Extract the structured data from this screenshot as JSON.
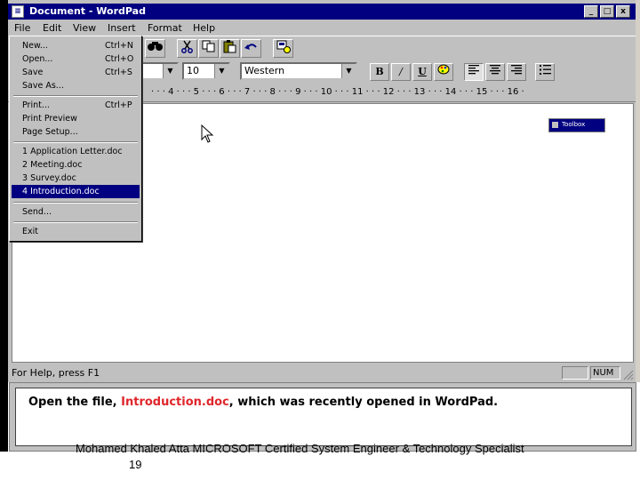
{
  "window": {
    "title": "Document - WordPad",
    "minimize": "_",
    "maximize": "□",
    "close": "x"
  },
  "menubar": {
    "items": [
      "File",
      "Edit",
      "View",
      "Insert",
      "Format",
      "Help"
    ]
  },
  "file_menu": {
    "items": [
      {
        "label": "New...",
        "shortcut": "Ctrl+N"
      },
      {
        "label": "Open...",
        "shortcut": "Ctrl+O"
      },
      {
        "label": "Save",
        "shortcut": "Ctrl+S"
      },
      {
        "label": "Save As...",
        "shortcut": ""
      },
      {
        "label": "Print...",
        "shortcut": "Ctrl+P"
      },
      {
        "label": "Print Preview",
        "shortcut": ""
      },
      {
        "label": "Page Setup...",
        "shortcut": ""
      },
      {
        "label": "1 Application Letter.doc",
        "shortcut": ""
      },
      {
        "label": "2 Meeting.doc",
        "shortcut": ""
      },
      {
        "label": "3 Survey.doc",
        "shortcut": ""
      },
      {
        "label": "4 Introduction.doc",
        "shortcut": "",
        "selected": true
      },
      {
        "label": "Send...",
        "shortcut": ""
      },
      {
        "label": "Exit",
        "shortcut": ""
      }
    ]
  },
  "toolbar": {
    "icons": [
      "find-icon",
      "cut-icon",
      "copy-icon",
      "paste-icon",
      "undo-icon",
      "insert-object-icon"
    ]
  },
  "format_bar": {
    "font_size": "10",
    "script": "Western",
    "bold": "B",
    "italic": "/",
    "underline": "U"
  },
  "ruler": {
    "text": "· · · 4 · · · 5 · · · 6 · · · 7 · · · 8 · · · 9 · · · 10 · · · 11 · · · 12 · · · 13 · · · 14 · · · 15 · · · 16 ·"
  },
  "toolbox": {
    "label": "Toolbox"
  },
  "statusbar": {
    "help_text": "For Help, press F1",
    "num": "NUM"
  },
  "instruction": {
    "prefix": "Open the file, ",
    "highlight": "Introduction.doc",
    "suffix": ", which was recently opened in WordPad."
  },
  "slide": {
    "credit": "Mohamed Khaled Atta MICROSOFT Certified System Engineer & Technology Specialist",
    "page_number": "19"
  },
  "colors": {
    "title_bar": "#000080",
    "selection": "#000080",
    "highlight_text": "#e0262b",
    "chrome": "#c0c0c0"
  }
}
